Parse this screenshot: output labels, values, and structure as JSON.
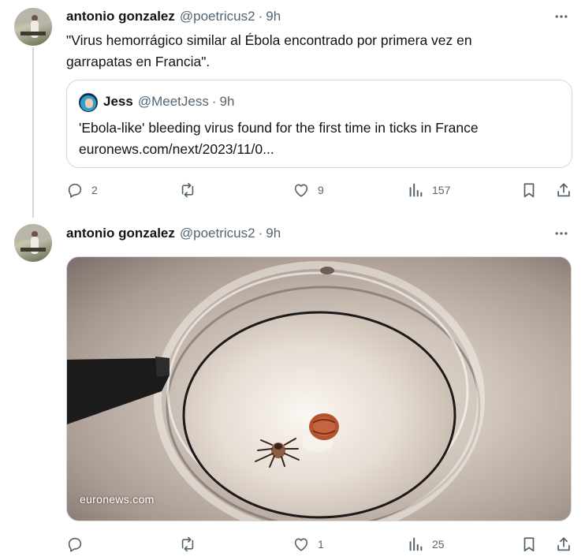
{
  "tweets": [
    {
      "display_name": "antonio gonzalez",
      "handle": "@poetricus2",
      "separator": "·",
      "time": "9h",
      "text_line1": "\"Virus hemorrágico similar al Ébola encontrado por primera vez en",
      "text_line2": "garrapatas en Francia\".",
      "quote": {
        "display_name": "Jess",
        "handle": "@MeetJess",
        "separator": "·",
        "time": "9h",
        "text_line1": "'Ebola-like' bleeding virus found for the first time in ticks in France",
        "text_line2": "euronews.com/next/2023/11/0..."
      },
      "actions": {
        "replies": "2",
        "retweets": "",
        "likes": "9",
        "views": "157"
      }
    },
    {
      "display_name": "antonio gonzalez",
      "handle": "@poetricus2",
      "separator": "·",
      "time": "9h",
      "media": {
        "watermark": "euronews.com"
      },
      "actions": {
        "replies": "",
        "retweets": "",
        "likes": "1",
        "views": "25"
      }
    }
  ],
  "icons": {
    "more": "more-horizontal-icon",
    "reply": "reply-icon",
    "retweet": "retweet-icon",
    "like": "heart-icon",
    "views": "views-icon",
    "bookmark": "bookmark-icon",
    "share": "share-icon"
  },
  "colors": {
    "text": "#0f1419",
    "secondary": "#536471",
    "border": "#cfd9de"
  }
}
